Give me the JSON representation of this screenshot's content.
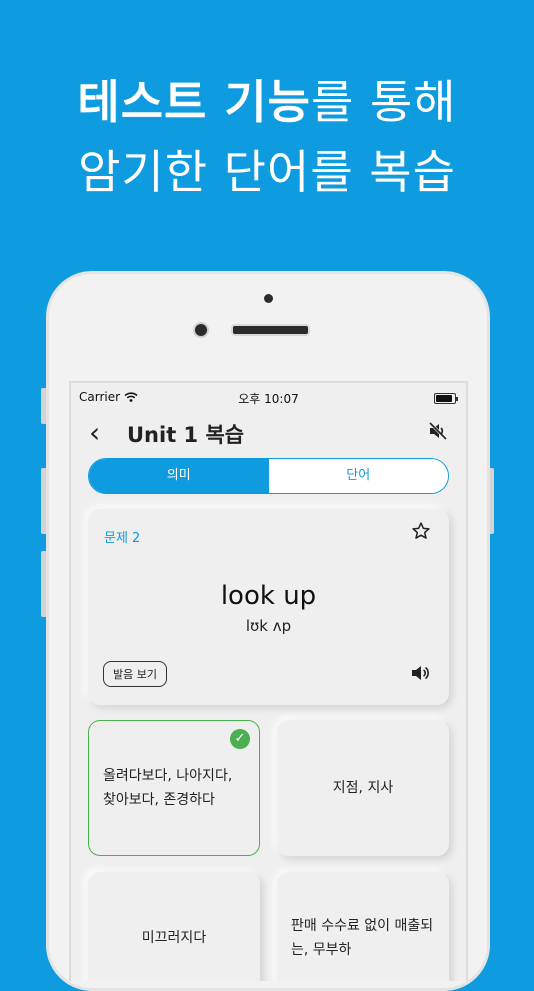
{
  "headline": {
    "line1_bold": "테스트 기능",
    "line1_rest": "를 통해",
    "line2": "암기한 단어를 복습"
  },
  "status_bar": {
    "carrier": "Carrier",
    "time": "오후 10:07"
  },
  "nav": {
    "back_glyph": "‹",
    "title": "Unit 1 복습"
  },
  "segments": [
    {
      "label": "의미",
      "selected": true
    },
    {
      "label": "단어",
      "selected": false
    }
  ],
  "question": {
    "number_label": "문제 2",
    "word": "look up",
    "ipa": "lʊk ʌp",
    "pronunciation_button": "발음 보기"
  },
  "options": [
    {
      "text": "올려다보다, 나아지다, 찾아보다, 존경하다",
      "correct": true
    },
    {
      "text": "지점, 지사",
      "correct": false
    },
    {
      "text": "미끄러지다",
      "correct": false
    },
    {
      "text": "판매 수수료 없이 매출되는, 무부하",
      "correct": false
    }
  ],
  "colors": {
    "background": "#0e9be0",
    "accent": "#0e9be0",
    "correct": "#4caf50"
  },
  "icons": [
    "wifi-icon",
    "battery-icon",
    "back-icon",
    "mute-icon",
    "star-icon",
    "speaker-icon",
    "check-icon"
  ]
}
